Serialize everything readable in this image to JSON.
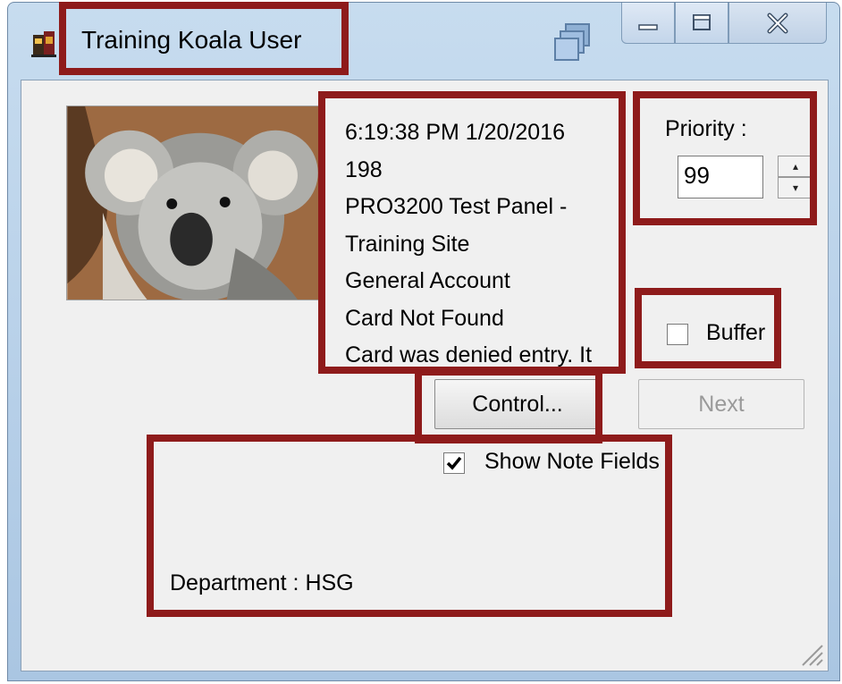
{
  "window": {
    "title": "Training Koala User"
  },
  "event_info": {
    "lines": [
      "6:19:38 PM 1/20/2016",
      "198",
      "PRO3200 Test Panel -",
      "Training Site",
      "General Account",
      "Card Not Found",
      "Card was denied entry.  It"
    ]
  },
  "priority": {
    "label": "Priority :",
    "value": "99"
  },
  "buffer": {
    "label": "Buffer",
    "checked": false
  },
  "buttons": {
    "control": "Control...",
    "next": "Next"
  },
  "notes": {
    "show_label": "Show Note Fields",
    "show_checked": true,
    "department": "Department :  HSG"
  },
  "highlight_color": "#8e1b1b"
}
